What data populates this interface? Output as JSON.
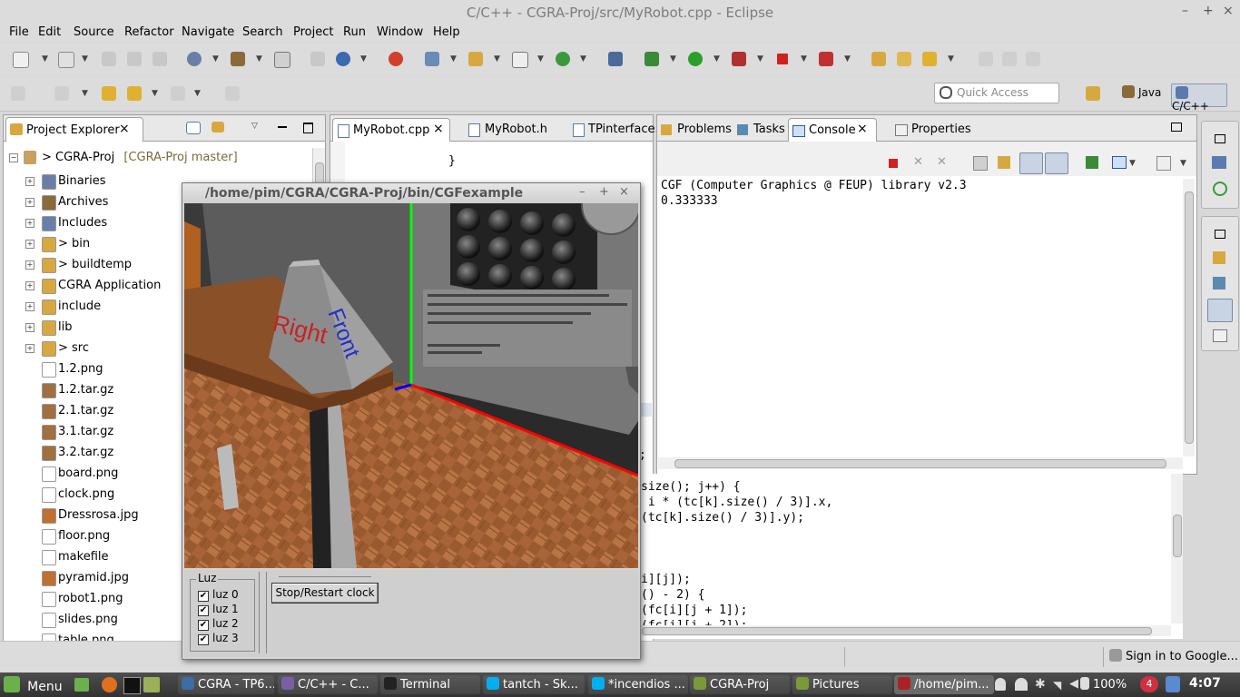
{
  "window": {
    "title": "C/C++ - CGRA-Proj/src/MyRobot.cpp - Eclipse",
    "min": "–",
    "max": "+",
    "close": "×"
  },
  "menu": [
    "File",
    "Edit",
    "Source",
    "Refactor",
    "Navigate",
    "Search",
    "Project",
    "Run",
    "Window",
    "Help"
  ],
  "toolbar": {
    "quick_access_placeholder": "Quick Access",
    "perspectives": [
      {
        "label": "Java"
      },
      {
        "label": "C/C++"
      }
    ]
  },
  "project_explorer": {
    "tab_label": "Project Explorer",
    "close": "×",
    "project": {
      "name": "> CGRA-Proj",
      "decoration": "[CGRA-Proj master]"
    },
    "items": [
      {
        "label": "Binaries",
        "icon": "binaries-icon",
        "expandable": true
      },
      {
        "label": "Archives",
        "icon": "archives-icon",
        "expandable": true
      },
      {
        "label": "Includes",
        "icon": "includes-icon",
        "expandable": true
      },
      {
        "label": "> bin",
        "icon": "folder-icon",
        "expandable": true
      },
      {
        "label": "> buildtemp",
        "icon": "folder-icon",
        "expandable": true
      },
      {
        "label": "CGRA Application",
        "icon": "folder-icon",
        "expandable": true
      },
      {
        "label": "include",
        "icon": "folder-icon",
        "expandable": true
      },
      {
        "label": "lib",
        "icon": "folder-icon",
        "expandable": true
      },
      {
        "label": "> src",
        "icon": "folder-icon",
        "expandable": true
      },
      {
        "label": "1.2.png",
        "icon": "file-icon",
        "expandable": false
      },
      {
        "label": "1.2.tar.gz",
        "icon": "archive-file-icon",
        "expandable": false
      },
      {
        "label": "2.1.tar.gz",
        "icon": "archive-file-icon",
        "expandable": false
      },
      {
        "label": "3.1.tar.gz",
        "icon": "archive-file-icon",
        "expandable": false
      },
      {
        "label": "3.2.tar.gz",
        "icon": "archive-file-icon",
        "expandable": false
      },
      {
        "label": "board.png",
        "icon": "file-icon",
        "expandable": false
      },
      {
        "label": "clock.png",
        "icon": "file-icon",
        "expandable": false
      },
      {
        "label": "Dressrosa.jpg",
        "icon": "image-file-icon",
        "expandable": false
      },
      {
        "label": "floor.png",
        "icon": "file-icon",
        "expandable": false
      },
      {
        "label": "makefile",
        "icon": "makefile-icon",
        "expandable": false
      },
      {
        "label": "pyramid.jpg",
        "icon": "image-file-icon",
        "expandable": false
      },
      {
        "label": "robot1.png",
        "icon": "file-icon",
        "expandable": false
      },
      {
        "label": "slides.png",
        "icon": "file-icon",
        "expandable": false
      },
      {
        "label": "table.png",
        "icon": "file-icon",
        "expandable": false
      }
    ]
  },
  "editor": {
    "tabs": [
      {
        "label": "MyRobot.cpp",
        "active": true,
        "close": "×"
      },
      {
        "label": "MyRobot.h"
      },
      {
        "label": "TPinterface."
      }
    ],
    "visible_code": "}"
  },
  "console_view": {
    "tabs": [
      {
        "label": "Problems"
      },
      {
        "label": "Tasks"
      },
      {
        "label": "Console",
        "active": true,
        "close": "×"
      },
      {
        "label": "Properties"
      }
    ],
    "lines": [
      "CGF (Computer Graphics @ FEUP) library v2.3",
      "0.333333"
    ]
  },
  "code_snippet": {
    "semicolon": ";",
    "lines": [
      "size(); j++) {",
      " i * (tc[k].size() / 3)].x,",
      "(tc[k].size() / 3)].y);",
      "",
      "",
      "",
      "i][j]);",
      "() - 2) {",
      "(fc[i][j + 1]);",
      "(fc[i][j + 2]);"
    ]
  },
  "status": {
    "signin": "Sign in to Google..."
  },
  "app_window": {
    "title": "/home/pim/CGRA/CGRA-Proj/bin/CGFexample",
    "controls": {
      "min": "–",
      "max": "+",
      "close": "×"
    },
    "scene": {
      "lamp_labels": [
        "Right",
        "Front"
      ]
    },
    "lights": {
      "group_label": "Luz",
      "items": [
        {
          "label": "luz 0",
          "checked": true
        },
        {
          "label": "luz 1",
          "checked": true
        },
        {
          "label": "luz 2",
          "checked": true
        },
        {
          "label": "luz 3",
          "checked": true
        }
      ],
      "check": "✔"
    },
    "clock_button": "Stop/Restart clock"
  },
  "taskbar": {
    "menu_label": "Menu",
    "tasks": [
      {
        "label": "CGRA - TP6...",
        "color": "#3a6ea5"
      },
      {
        "label": "C/C++ - C...",
        "color": "#7b5ea7"
      },
      {
        "label": "Terminal",
        "color": "#222222"
      },
      {
        "label": "tantch - Sk...",
        "color": "#00aff0"
      },
      {
        "label": "*incendios ...",
        "color": "#00aff0"
      },
      {
        "label": "CGRA-Proj",
        "color": "#7a9a3a"
      },
      {
        "label": "Pictures",
        "color": "#7a9a3a"
      },
      {
        "label": "/home/pim...",
        "color": "#aa2222"
      }
    ],
    "battery": "100%",
    "notif_count": "4",
    "clock": "4:07"
  }
}
